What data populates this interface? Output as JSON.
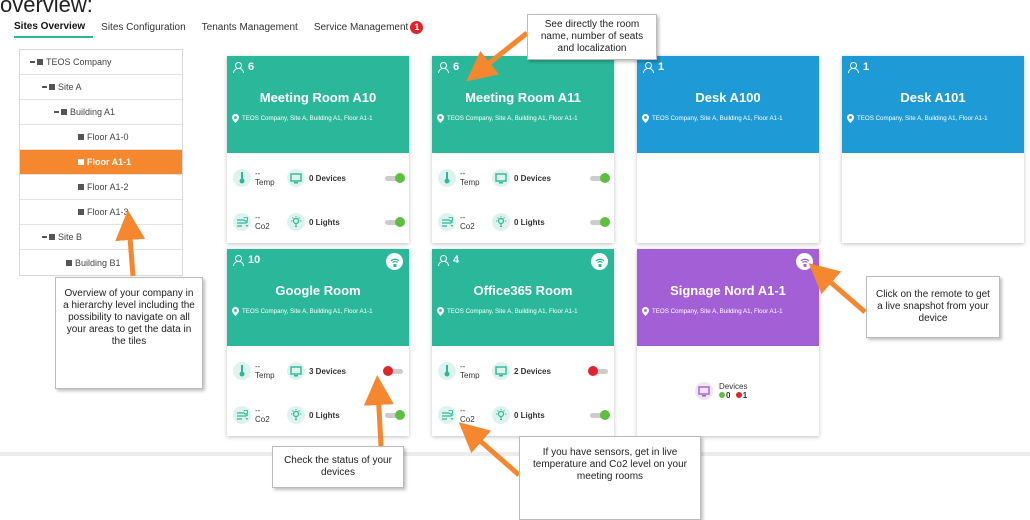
{
  "page_heading": "overview:",
  "tabs": [
    {
      "label": "Sites Overview",
      "active": true
    },
    {
      "label": "Sites Configuration"
    },
    {
      "label": "Tenants Management"
    },
    {
      "label": "Service Management",
      "badge": "1"
    }
  ],
  "tree": [
    {
      "label": "TEOS Company",
      "level": 0,
      "expand": true
    },
    {
      "label": "Site A",
      "level": 1,
      "expand": true
    },
    {
      "label": "Building A1",
      "level": 2,
      "expand": true
    },
    {
      "label": "Floor A1-0",
      "level": 3
    },
    {
      "label": "Floor A1-1",
      "level": 3,
      "selected": true
    },
    {
      "label": "Floor A1-2",
      "level": 3
    },
    {
      "label": "Floor A1-3",
      "level": 3
    },
    {
      "label": "Site B",
      "level": 1,
      "expand": true
    },
    {
      "label": "Building B1",
      "level": 2
    }
  ],
  "tiles": {
    "a10": {
      "seats": "6",
      "name": "Meeting Room A10",
      "location": "TEOS Company, Site A, Building A1, Floor A1-1",
      "temp_value": "--",
      "temp_label": "Temp",
      "devices": "0 Devices",
      "co2_value": "--",
      "co2_label": "Co2",
      "lights": "0 Lights",
      "devices_toggle": "on",
      "lights_toggle": "on"
    },
    "a11": {
      "seats": "6",
      "name": "Meeting Room A11",
      "location": "TEOS Company, Site A, Building A1, Floor A1-1",
      "temp_value": "--",
      "temp_label": "Temp",
      "devices": "0 Devices",
      "co2_value": "--",
      "co2_label": "Co2",
      "lights": "0 Lights",
      "devices_toggle": "on",
      "lights_toggle": "on"
    },
    "a100": {
      "seats": "1",
      "name": "Desk A100",
      "location": "TEOS Company, Site A, Building A1, Floor A1-1"
    },
    "a101": {
      "seats": "1",
      "name": "Desk A101",
      "location": "TEOS Company, Site A, Building A1, Floor A1-1"
    },
    "google": {
      "seats": "10",
      "name": "Google Room",
      "location": "TEOS Company, Site A, Building A1, Floor A1-1",
      "temp_value": "--",
      "temp_label": "Temp",
      "devices": "3 Devices",
      "co2_value": "--",
      "co2_label": "Co2",
      "lights": "0 Lights",
      "devices_toggle": "off",
      "lights_toggle": "on"
    },
    "o365": {
      "seats": "4",
      "name": "Office365 Room",
      "location": "TEOS Company, Site A, Building A1, Floor A1-1",
      "temp_value": "--",
      "temp_label": "Temp",
      "devices": "2 Devices",
      "co2_value": "--",
      "co2_label": "Co2",
      "lights": "0 Lights",
      "devices_toggle": "off",
      "lights_toggle": "on"
    },
    "signage": {
      "name": "Signage Nord A1-1",
      "location": "TEOS Company, Site A, Building A1, Floor A1-1",
      "devices_label": "Devices",
      "online": "0",
      "offline": "1"
    }
  },
  "callouts": {
    "room_info": "See directly the room name, number of seats and localization",
    "hierarchy": "Overview of your company in a hierarchy level including the possibility to navigate on all your areas to get the data in the tiles",
    "remote": "Click on the remote to get a live snapshot from your device",
    "status": "Check the status of your devices",
    "sensors": "If you have sensors, get in live temperature and Co2 level on your meeting rooms"
  },
  "colors": {
    "green": "#2bb89a",
    "blue": "#1e9ad6",
    "purple": "#a35fd6",
    "orange": "#f5872f",
    "on": "#5cbf3f",
    "off": "#e2232a"
  }
}
